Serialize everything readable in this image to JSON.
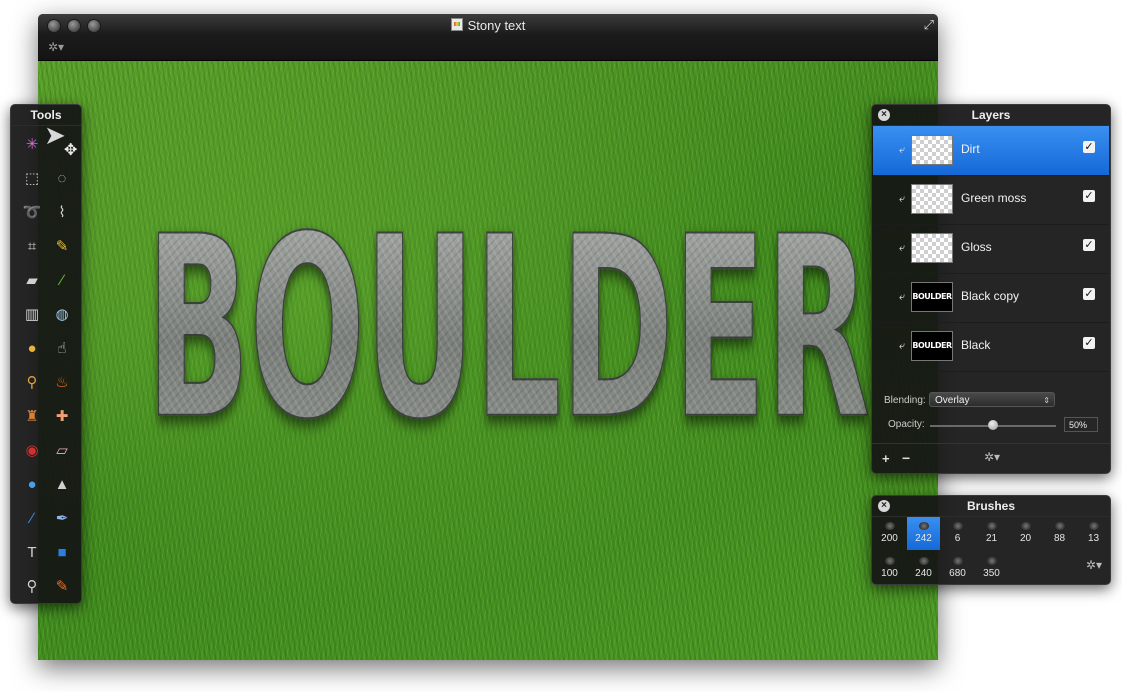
{
  "window": {
    "title": "Stony text",
    "fullscreen_icon": "fullscreen-icon",
    "gear_icon": "gear-icon"
  },
  "canvas": {
    "text": "BOULDER"
  },
  "tools": {
    "title": "Tools",
    "items": [
      [
        "magic-wand-icon",
        "move-arrow-icon"
      ],
      [
        "rect-select-icon",
        "ellipse-select-icon"
      ],
      [
        "lasso-icon",
        "polygon-lasso-icon"
      ],
      [
        "crop-icon",
        "eyedropper-icon"
      ],
      [
        "eraser-icon",
        "brush-icon"
      ],
      [
        "gradient-icon",
        "paint-bucket-icon"
      ],
      [
        "sponge-icon",
        "smudge-icon"
      ],
      [
        "dodge-icon",
        "burn-icon"
      ],
      [
        "clone-stamp-icon",
        "heal-icon"
      ],
      [
        "red-eye-icon",
        "eraser-pink-icon"
      ],
      [
        "blur-icon",
        "sharpen-icon"
      ],
      [
        "pen-icon",
        "vector-pen-icon"
      ],
      [
        "text-icon",
        "shape-icon"
      ],
      [
        "zoom-icon",
        "color-picker-icon"
      ]
    ]
  },
  "layers": {
    "title": "Layers",
    "rows": [
      {
        "name": "Dirt",
        "thumb": "dirt",
        "selected": true,
        "visible": true
      },
      {
        "name": "Green moss",
        "thumb": "transparent",
        "selected": false,
        "visible": true
      },
      {
        "name": "Gloss",
        "thumb": "transparent",
        "selected": false,
        "visible": true
      },
      {
        "name": "Black copy",
        "thumb": "dark",
        "thumb_text": "BOULDER",
        "selected": false,
        "visible": true
      },
      {
        "name": "Black",
        "thumb": "dark",
        "thumb_text": "BOULDER",
        "selected": false,
        "visible": true
      }
    ],
    "blending_label": "Blending:",
    "blending_value": "Overlay",
    "opacity_label": "Opacity:",
    "opacity_value": "50%",
    "opacity_fraction": 0.5,
    "add_label": "+",
    "remove_label": "−"
  },
  "brushes": {
    "title": "Brushes",
    "items": [
      {
        "size": "200",
        "selected": false
      },
      {
        "size": "242",
        "selected": true
      },
      {
        "size": "6",
        "selected": false
      },
      {
        "size": "21",
        "selected": false
      },
      {
        "size": "20",
        "selected": false
      },
      {
        "size": "88",
        "selected": false
      },
      {
        "size": "13",
        "selected": false
      },
      {
        "size": "100",
        "selected": false
      },
      {
        "size": "240",
        "selected": false
      },
      {
        "size": "680",
        "selected": false
      },
      {
        "size": "350",
        "selected": false
      }
    ]
  },
  "colors": {
    "selection": "#1f7ae8",
    "panel_bg": "#141414"
  }
}
